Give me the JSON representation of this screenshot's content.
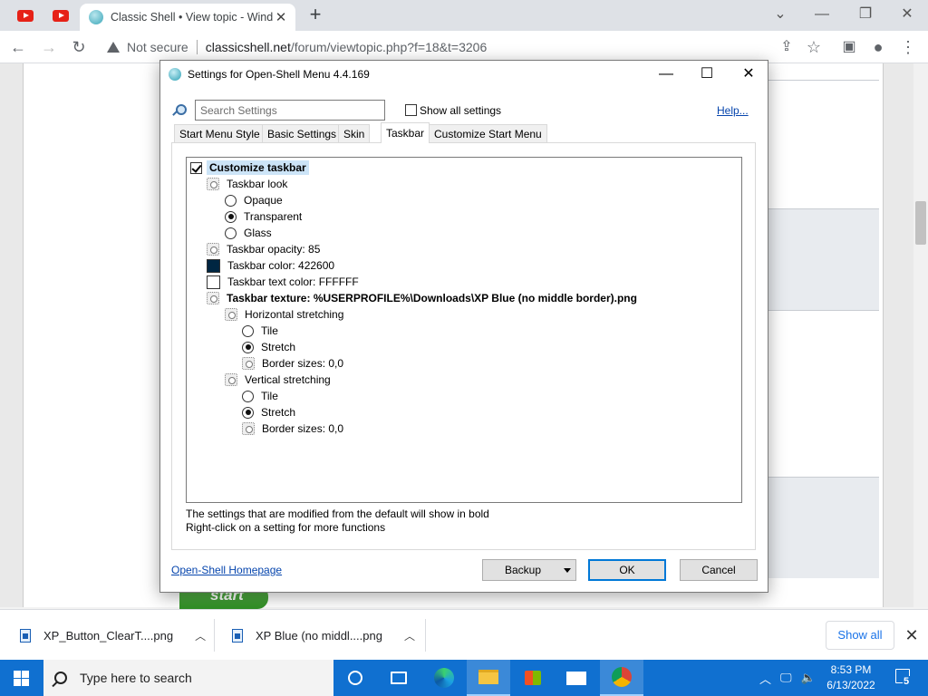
{
  "browser": {
    "tab_title": "Classic Shell • View topic - Wind",
    "not_secure": "Not secure",
    "url_domain": "classicshell.net",
    "url_path": "/forum/viewtopic.php?f=18&t=3206"
  },
  "dialog": {
    "title": "Settings for Open-Shell Menu 4.4.169",
    "search_placeholder": "Search Settings",
    "show_all_label": "Show all settings",
    "help_label": "Help...",
    "tabs": [
      "Start Menu Style",
      "Basic Settings",
      "Skin",
      "Taskbar",
      "Customize Start Menu"
    ],
    "selected_tab": "Taskbar",
    "tree": [
      {
        "label": "Customize taskbar",
        "kind": "checkbox",
        "checked": true,
        "bold": true,
        "highlight": true
      },
      {
        "label": "Taskbar look",
        "kind": "gear"
      },
      {
        "label": "Opaque",
        "kind": "radio",
        "checked": false
      },
      {
        "label": "Transparent",
        "kind": "radio",
        "checked": true
      },
      {
        "label": "Glass",
        "kind": "radio",
        "checked": false
      },
      {
        "label": "Taskbar opacity: 85",
        "kind": "gear"
      },
      {
        "label": "Taskbar color: 422600",
        "kind": "swatch",
        "color": "#002642"
      },
      {
        "label": "Taskbar text color: FFFFFF",
        "kind": "swatch",
        "color": "#FFFFFF"
      },
      {
        "label": "Taskbar texture: %USERPROFILE%\\Downloads\\XP Blue (no middle border).png",
        "kind": "gear",
        "bold": true
      },
      {
        "label": "Horizontal stretching",
        "kind": "gear"
      },
      {
        "label": "Tile",
        "kind": "radio",
        "checked": false
      },
      {
        "label": "Stretch",
        "kind": "radio",
        "checked": true
      },
      {
        "label": "Border sizes: 0,0",
        "kind": "gear"
      },
      {
        "label": "Vertical stretching",
        "kind": "gear"
      },
      {
        "label": "Tile",
        "kind": "radio",
        "checked": false
      },
      {
        "label": "Stretch",
        "kind": "radio",
        "checked": true
      },
      {
        "label": "Border sizes: 0,0",
        "kind": "gear"
      }
    ],
    "note1": "The settings that are modified from the default will show in bold",
    "note2": "Right-click on a setting for more functions",
    "homepage_link": "Open-Shell Homepage",
    "backup_label": "Backup",
    "ok_label": "OK",
    "cancel_label": "Cancel"
  },
  "page": {
    "start_button_text": "start"
  },
  "downloads": {
    "items": [
      "XP_Button_ClearT....png",
      "XP Blue (no middl....png"
    ],
    "show_all": "Show all"
  },
  "taskbar": {
    "search_placeholder": "Type here to search",
    "time": "8:53 PM",
    "date": "6/13/2022",
    "notification_count": "5"
  }
}
